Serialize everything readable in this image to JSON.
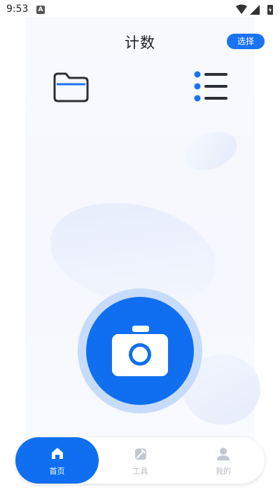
{
  "status_bar": {
    "time": "9:53",
    "indicator": "A"
  },
  "header": {
    "title": "计数",
    "select_label": "选择"
  },
  "icons": {
    "left": "folder-icon",
    "right": "list-icon",
    "center": "camera-icon"
  },
  "tabs": [
    {
      "label": "首页",
      "icon": "home-icon",
      "active": true
    },
    {
      "label": "工具",
      "icon": "tools-icon",
      "active": false
    },
    {
      "label": "我的",
      "icon": "user-icon",
      "active": false
    }
  ],
  "colors": {
    "accent": "#0f6ff0",
    "ring": "#c7dcfb",
    "inactive": "#b8bec8"
  }
}
